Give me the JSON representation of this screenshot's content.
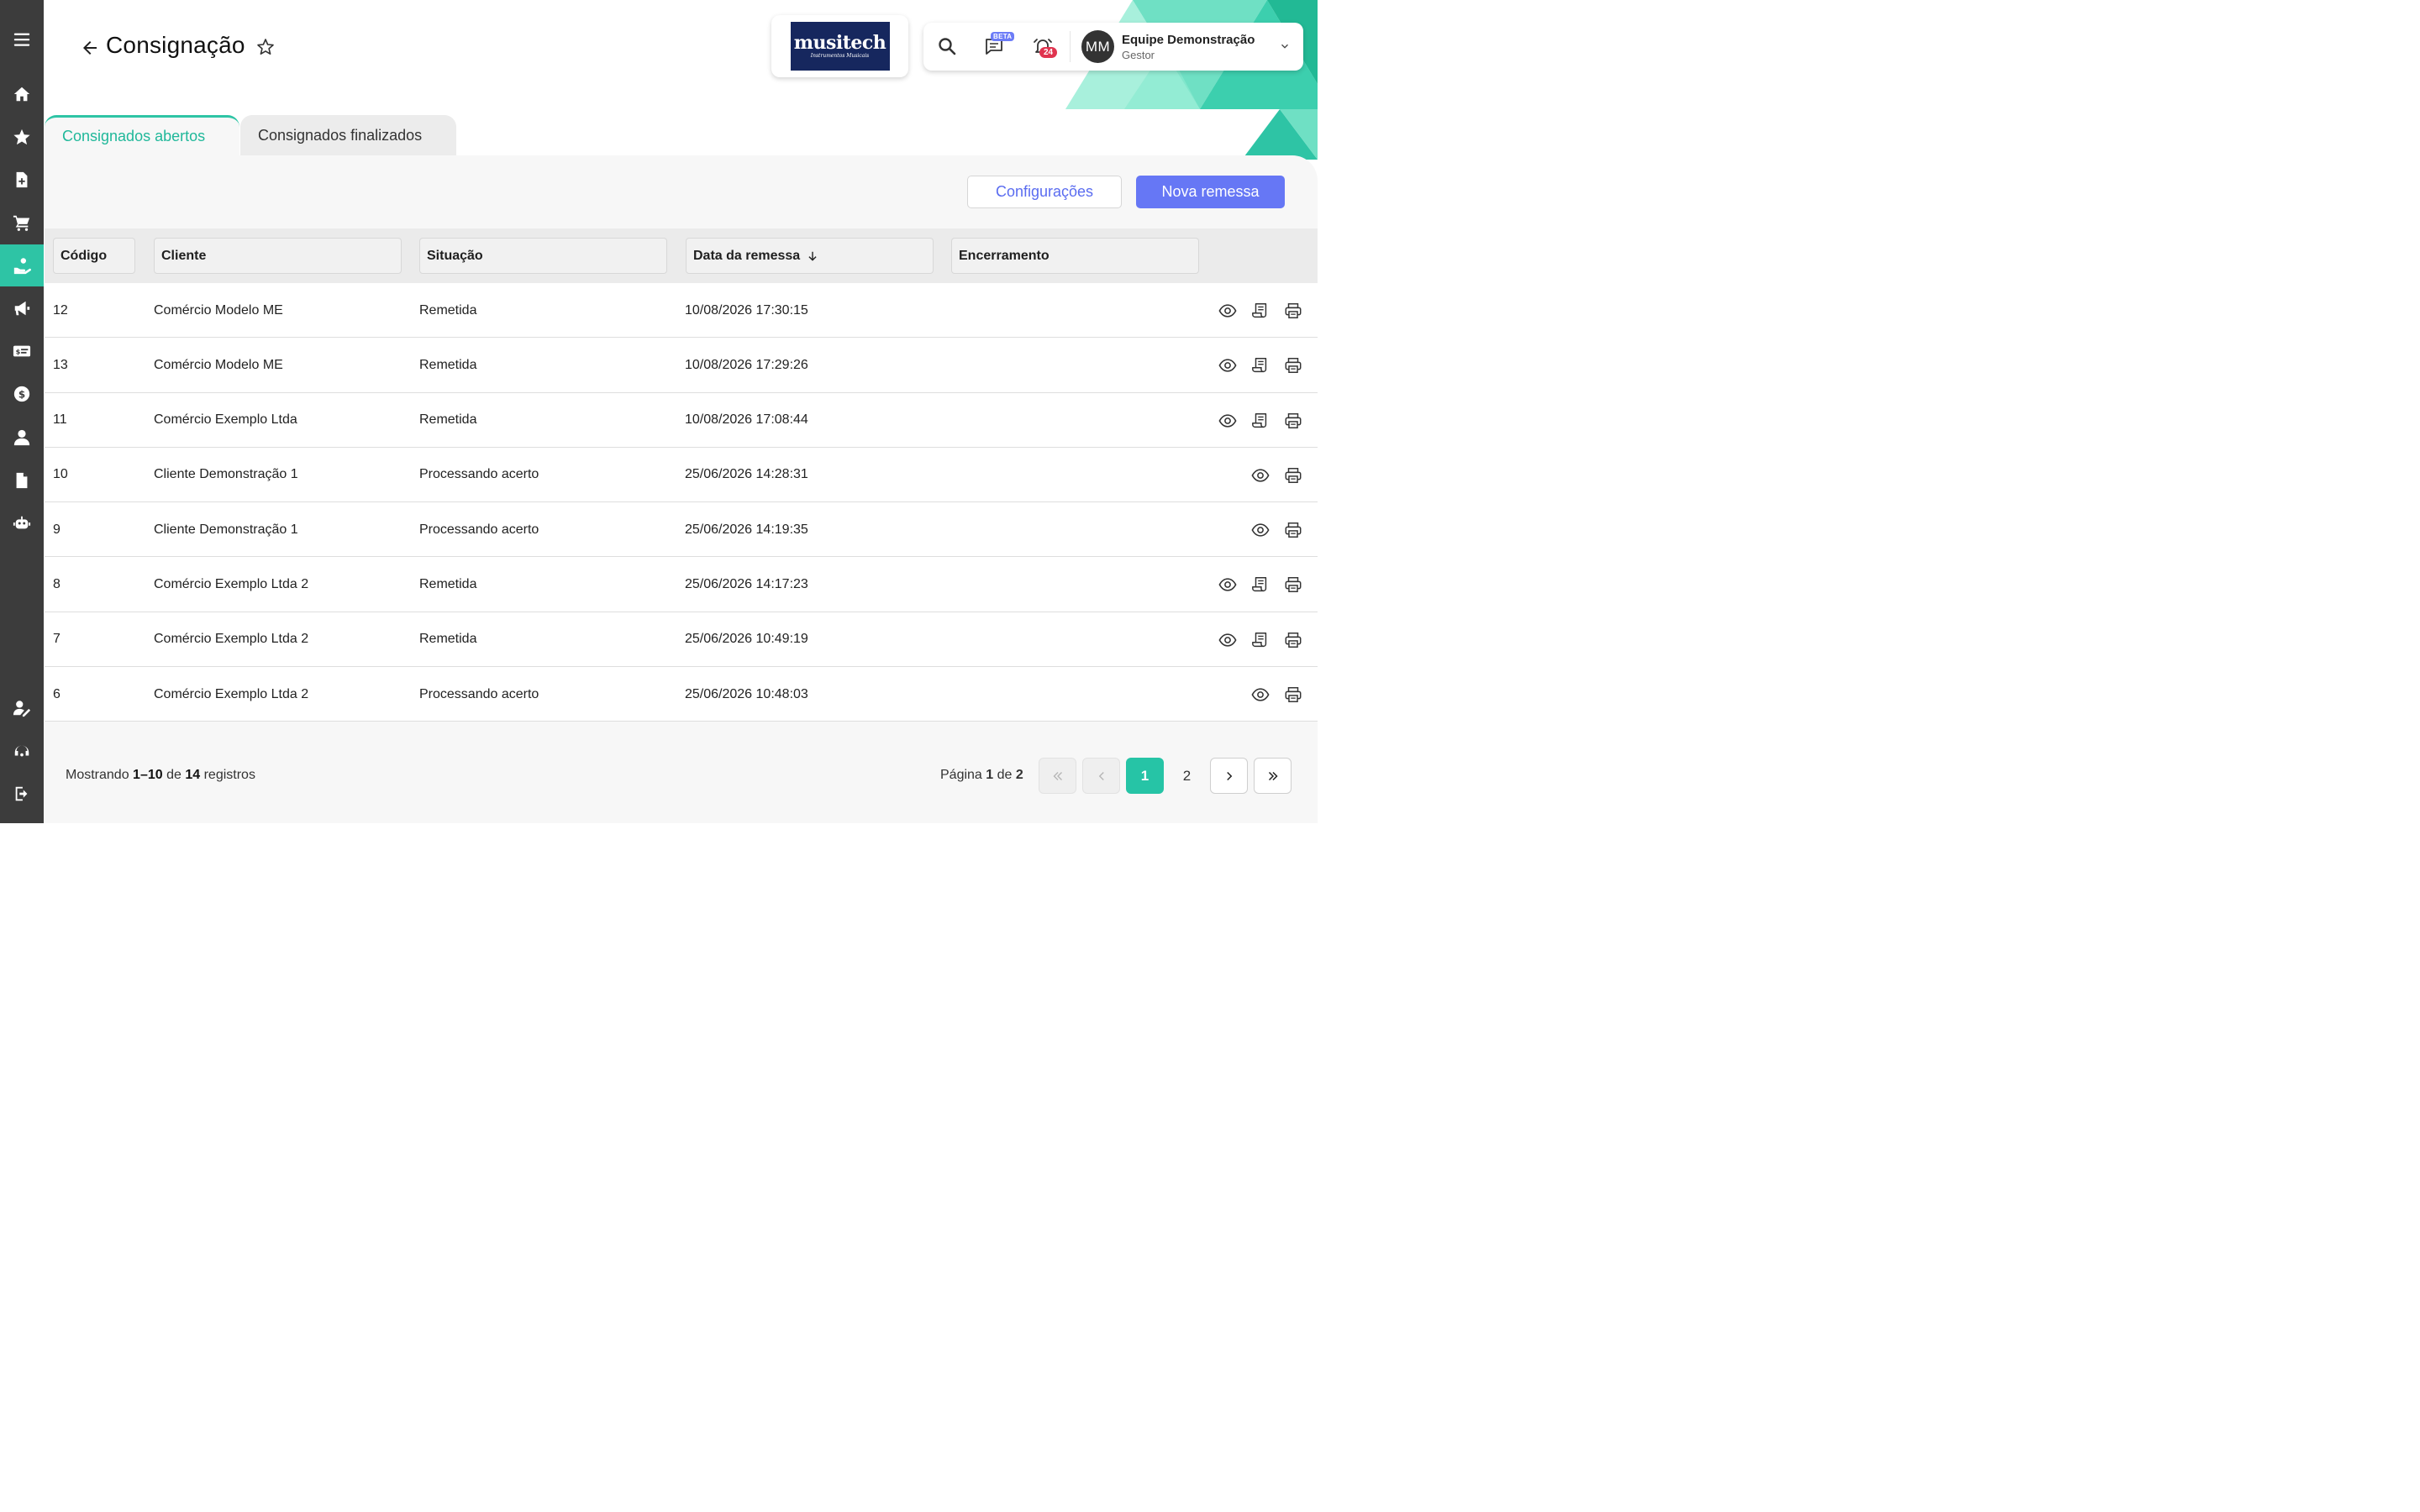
{
  "sidebar": {
    "items": [
      {
        "name": "menu-icon"
      },
      {
        "name": "home-icon"
      },
      {
        "name": "star-icon"
      },
      {
        "name": "document-add-icon"
      },
      {
        "name": "cart-icon"
      },
      {
        "name": "hand-coin-icon",
        "active": true
      },
      {
        "name": "megaphone-icon"
      },
      {
        "name": "money-card-icon"
      },
      {
        "name": "dollar-circle-icon"
      },
      {
        "name": "users-icon"
      },
      {
        "name": "file-icon"
      },
      {
        "name": "robot-icon"
      },
      {
        "name": "user-edit-icon"
      },
      {
        "name": "headset-icon"
      },
      {
        "name": "logout-icon"
      }
    ]
  },
  "header": {
    "title": "Consignação",
    "logo": {
      "main": "musitech",
      "sub": "Instrumentos Musicais"
    },
    "beta_label": "BETA",
    "notification_count": "24",
    "user": {
      "initials": "MM",
      "name": "Equipe Demonstração",
      "role": "Gestor"
    }
  },
  "tabs": [
    {
      "label": "Consignados abertos",
      "active": true
    },
    {
      "label": "Consignados finalizados",
      "active": false
    }
  ],
  "actions": {
    "config_label": "Configurações",
    "new_label": "Nova remessa"
  },
  "table": {
    "columns": [
      "Código",
      "Cliente",
      "Situação",
      "Data da remessa",
      "Encerramento"
    ],
    "rows": [
      {
        "code": "12",
        "client": "Comércio Modelo ME",
        "status": "Remetida",
        "date": "10/08/2026 17:30:15",
        "end": "",
        "actions": [
          "view",
          "receipt",
          "print"
        ]
      },
      {
        "code": "13",
        "client": "Comércio Modelo ME",
        "status": "Remetida",
        "date": "10/08/2026 17:29:26",
        "end": "",
        "actions": [
          "view",
          "receipt",
          "print"
        ]
      },
      {
        "code": "11",
        "client": "Comércio Exemplo Ltda",
        "status": "Remetida",
        "date": "10/08/2026 17:08:44",
        "end": "",
        "actions": [
          "view",
          "receipt",
          "print"
        ]
      },
      {
        "code": "10",
        "client": "Cliente Demonstração 1",
        "status": "Processando acerto",
        "date": "25/06/2026 14:28:31",
        "end": "",
        "actions": [
          "view",
          "print"
        ]
      },
      {
        "code": "9",
        "client": "Cliente Demonstração 1",
        "status": "Processando acerto",
        "date": "25/06/2026 14:19:35",
        "end": "",
        "actions": [
          "view",
          "print"
        ]
      },
      {
        "code": "8",
        "client": "Comércio Exemplo Ltda 2",
        "status": "Remetida",
        "date": "25/06/2026 14:17:23",
        "end": "",
        "actions": [
          "view",
          "receipt",
          "print"
        ]
      },
      {
        "code": "7",
        "client": "Comércio Exemplo Ltda 2",
        "status": "Remetida",
        "date": "25/06/2026 10:49:19",
        "end": "",
        "actions": [
          "view",
          "receipt",
          "print"
        ]
      },
      {
        "code": "6",
        "client": "Comércio Exemplo Ltda 2",
        "status": "Processando acerto",
        "date": "25/06/2026 10:48:03",
        "end": "",
        "actions": [
          "view",
          "print"
        ]
      }
    ]
  },
  "footer": {
    "showing_prefix": "Mostrando",
    "range": "1–10",
    "of": "de",
    "total": "14",
    "records": "registros",
    "page_prefix": "Página",
    "current_page": "1",
    "page_of": "de",
    "total_pages": "2",
    "pages": [
      "1",
      "2"
    ]
  },
  "colors": {
    "accent": "#2ec4a5",
    "primary": "#6677f5",
    "sidebar": "#3c3c3c",
    "badge": "#e0344f"
  }
}
